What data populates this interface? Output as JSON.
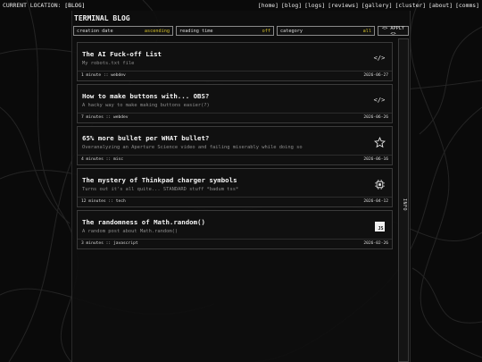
{
  "topbar": {
    "location_prefix": "CURRENT LOCATION: ",
    "location_current": "[BLOG]",
    "nav": [
      "[home]",
      "[blog]",
      "[logs]",
      "[reviews]",
      "[gallery]",
      "[cluster]",
      "[about]",
      "[comms]"
    ]
  },
  "page": {
    "title": "TERMINAL BLOG"
  },
  "filters": [
    {
      "label": "creation date",
      "value": "ascending"
    },
    {
      "label": "reading time",
      "value": "off"
    },
    {
      "label": "category",
      "value": "all"
    }
  ],
  "apply_label": "<> APPLY <>",
  "posts": [
    {
      "title": "The AI Fuck-off List",
      "description": "My robots.txt file",
      "meta": "1 minute :: webdev",
      "date": "2026-06-27",
      "icon": "code-icon"
    },
    {
      "title": "How to make buttons with... OBS?",
      "description": "A hacky way to make making buttons easier(?)",
      "meta": "7 minutes :: webdev",
      "date": "2026-06-26",
      "icon": "code-icon"
    },
    {
      "title": "65% more bullet per WHAT bullet?",
      "description": "Overanalyzing an Aperture Science video and failing miserably while doing so",
      "meta": "4 minutes :: misc",
      "date": "2026-06-16",
      "icon": "star-icon"
    },
    {
      "title": "The mystery of Thinkpad charger symbols",
      "description": "Turns out it's all quite... STANDARD stuff *badum tss*",
      "meta": "12 minutes :: tech",
      "date": "2026-04-12",
      "icon": "chip-icon"
    },
    {
      "title": "The randomness of Math.random()",
      "description": "A random post about Math.random()",
      "meta": "3 minutes :: javascript",
      "date": "2026-02-26",
      "icon": "js-icon"
    }
  ],
  "icons": {
    "code_glyph": "</>",
    "star_glyph": "☆",
    "js_text": "JS"
  },
  "info_panel": {
    "label": "INFO"
  }
}
